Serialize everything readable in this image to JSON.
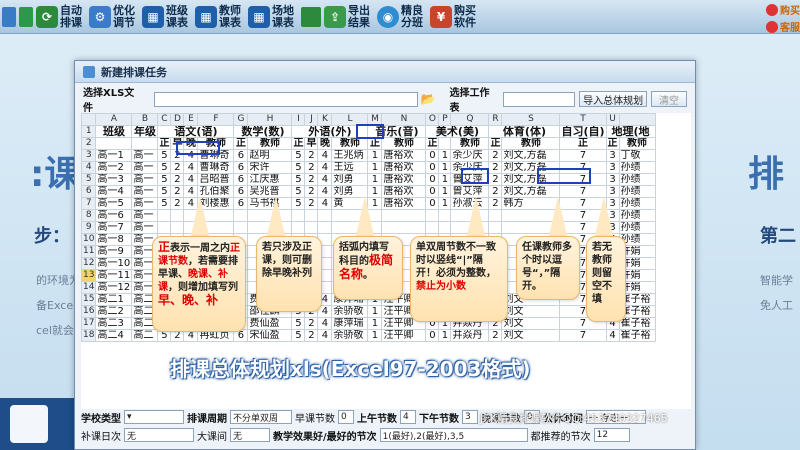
{
  "toolbar": {
    "items": [
      {
        "label": "自动排课",
        "icon": "auto-schedule-icon",
        "color": "#2d8a3c"
      },
      {
        "label": "优化调节",
        "icon": "optimize-icon",
        "color": "#3b7bc9"
      },
      {
        "label": "班级课表",
        "icon": "class-table-icon",
        "color": "#1f5fa8"
      },
      {
        "label": "教师课表",
        "icon": "teacher-table-icon",
        "color": "#1f5fa8"
      },
      {
        "label": "场地课表",
        "icon": "venue-table-icon",
        "color": "#1f5fa8"
      },
      {
        "label": "导出结果",
        "icon": "export-icon",
        "color": "#3a9a4a"
      },
      {
        "label": "精良分班",
        "icon": "split-class-icon",
        "color": "#2f8cd0"
      },
      {
        "label": "购买软件",
        "icon": "buy-icon",
        "color": "#c8442a"
      }
    ],
    "qq1": "购买",
    "qq2": "客服"
  },
  "background": {
    "left_big": ":课",
    "left_step": "步：",
    "left_small1": "的环境为",
    "left_small2": "备Excel",
    "left_small3": "cel就会",
    "right_big": "排",
    "right_mid": "第二",
    "right_small1": "智能学",
    "right_small2": "免人工"
  },
  "dialog": {
    "title": "新建排课任务",
    "file_label": "选择XLS文件",
    "sheet_label": "选择工作表",
    "import_btn": "导入总体规划",
    "clear_btn": "清空"
  },
  "sheet": {
    "col_letters": [
      "A",
      "B",
      "C",
      "D",
      "E",
      "F",
      "G",
      "H",
      "I",
      "J",
      "K",
      "L",
      "M",
      "N",
      "O",
      "P",
      "Q",
      "R",
      "S",
      "T",
      "U"
    ],
    "row_numbers": [
      "1",
      "2",
      "3",
      "4",
      "5",
      "6",
      "7",
      "8",
      "9",
      "10",
      "11",
      "12",
      "13",
      "14",
      "15",
      "16",
      "17",
      "18"
    ],
    "header1": {
      "class": "班级",
      "grade": "年级",
      "chinese": "语文(语)",
      "math": "数学(数)",
      "foreign": "外语(外)",
      "music": "音乐(音)",
      "art": "美术(美)",
      "pe": "体育(体)",
      "self": "自习(自)",
      "geo": "地理(地"
    },
    "header2": {
      "zheng": "正",
      "zao": "早",
      "wan": "晚",
      "teacher": "教师"
    },
    "rows": [
      {
        "cls": "高一1",
        "g": "高一",
        "c1": "5",
        "c2": "2",
        "c3": "4",
        "t1": "曹琳奇",
        "m1": "6",
        "t2": "赵明",
        "f1": "5",
        "f2": "2",
        "f3": "4",
        "t3": "王兆炳",
        "mu": "1",
        "t4": "唐裕欢",
        "a1": "0",
        "a2": "1",
        "t5": "余少庆",
        "p1": "2",
        "t6": "刘文,方磊",
        "s1": "7",
        "g1": "3",
        "t7": "丁敬"
      },
      {
        "cls": "高一2",
        "g": "高一",
        "c1": "5",
        "c2": "2",
        "c3": "4",
        "t1": "曹琳奇",
        "m1": "6",
        "t2": "宋许",
        "f1": "5",
        "f2": "2",
        "f3": "4",
        "t3": "王远",
        "mu": "1",
        "t4": "唐裕欢",
        "a1": "0",
        "a2": "1",
        "t5": "余少庆",
        "p1": "2",
        "t6": "刘文,方磊",
        "s1": "7",
        "g1": "3",
        "t7": "孙绩"
      },
      {
        "cls": "高一3",
        "g": "高一",
        "c1": "5",
        "c2": "2",
        "c3": "4",
        "t1": "吕昭普",
        "m1": "6",
        "t2": "江庆惠",
        "f1": "5",
        "f2": "2",
        "f3": "4",
        "t3": "刘勇",
        "mu": "1",
        "t4": "唐裕欢",
        "a1": "0",
        "a2": "1",
        "t5": "曾艾萍",
        "p1": "2",
        "t6": "刘文,方磊",
        "s1": "7",
        "g1": "3",
        "t7": "孙绩"
      },
      {
        "cls": "高一4",
        "g": "高一",
        "c1": "5",
        "c2": "2",
        "c3": "4",
        "t1": "孔伯聚",
        "m1": "6",
        "t2": "吴兆普",
        "f1": "5",
        "f2": "2",
        "f3": "4",
        "t3": "刘勇",
        "mu": "1",
        "t4": "唐裕欢",
        "a1": "0",
        "a2": "1",
        "t5": "曾艾萍",
        "p1": "2",
        "t6": "刘文,方磊",
        "s1": "7",
        "g1": "3",
        "t7": "孙绩"
      },
      {
        "cls": "高一5",
        "g": "高一",
        "c1": "5",
        "c2": "2",
        "c3": "4",
        "t1": "刘楼惠",
        "m1": "6",
        "t2": "马书祺",
        "f1": "5",
        "f2": "2",
        "f3": "4",
        "t3": "黄",
        "mu": "1",
        "t4": "唐裕欢",
        "a1": "0",
        "a2": "1",
        "t5": "孙淑云",
        "p1": "2",
        "t6": "韩方",
        "s1": "7",
        "g1": "3",
        "t7": "孙绩"
      },
      {
        "cls": "高一6",
        "g": "高一",
        "c1": "",
        "c2": "",
        "c3": "",
        "t1": "",
        "m1": "",
        "t2": "",
        "f1": "",
        "f2": "",
        "f3": "",
        "t3": "",
        "mu": "",
        "t4": "",
        "a1": "",
        "a2": "",
        "t5": "",
        "p1": "",
        "t6": "",
        "s1": "7",
        "g1": "3",
        "t7": "孙绩"
      },
      {
        "cls": "高一7",
        "g": "高一",
        "c1": "",
        "c2": "",
        "c3": "",
        "t1": "",
        "m1": "",
        "t2": "",
        "f1": "",
        "f2": "",
        "f3": "",
        "t3": "",
        "mu": "",
        "t4": "",
        "a1": "",
        "a2": "",
        "t5": "",
        "p1": "",
        "t6": "",
        "s1": "7",
        "g1": "3",
        "t7": "孙绩"
      },
      {
        "cls": "高一8",
        "g": "高一",
        "c1": "",
        "c2": "",
        "c3": "",
        "t1": "",
        "m1": "",
        "t2": "",
        "f1": "",
        "f2": "",
        "f3": "",
        "t3": "",
        "mu": "",
        "t4": "",
        "a1": "",
        "a2": "",
        "t5": "",
        "p1": "",
        "t6": "",
        "s1": "7",
        "g1": "3",
        "t7": "孙绩"
      },
      {
        "cls": "高一9",
        "g": "高一",
        "c1": "",
        "c2": "",
        "c3": "",
        "t1": "",
        "m1": "",
        "t2": "",
        "f1": "",
        "f2": "",
        "f3": "",
        "t3": "",
        "mu": "",
        "t4": "",
        "a1": "",
        "a2": "",
        "t5": "",
        "p1": "",
        "t6": "",
        "s1": "7",
        "g1": "3",
        "t7": "许娟"
      },
      {
        "cls": "高一10",
        "g": "高一",
        "c1": "",
        "c2": "",
        "c3": "",
        "t1": "",
        "m1": "",
        "t2": "",
        "f1": "",
        "f2": "",
        "f3": "",
        "t3": "",
        "mu": "",
        "t4": "",
        "a1": "",
        "a2": "",
        "t5": "",
        "p1": "",
        "t6": "",
        "s1": "7",
        "g1": "3",
        "t7": "许娟"
      },
      {
        "cls": "高一11",
        "g": "高一",
        "c1": "",
        "c2": "",
        "c3": "",
        "t1": "",
        "m1": "",
        "t2": "",
        "f1": "",
        "f2": "",
        "f3": "",
        "t3": "",
        "mu": "",
        "t4": "",
        "a1": "",
        "a2": "",
        "t5": "",
        "p1": "",
        "t6": "",
        "s1": "7",
        "g1": "3",
        "t7": "许娟"
      },
      {
        "cls": "高一12",
        "g": "高一",
        "c1": "",
        "c2": "",
        "c3": "",
        "t1": "",
        "m1": "",
        "t2": "",
        "f1": "",
        "f2": "",
        "f3": "",
        "t3": "",
        "mu": "",
        "t4": "",
        "a1": "",
        "a2": "",
        "t5": "",
        "p1": "",
        "t6": "",
        "s1": "7",
        "g1": "3",
        "t7": "许娟"
      },
      {
        "cls": "高二1",
        "g": "高二",
        "c1": "5",
        "c2": "2",
        "c3": "4",
        "t1": "蒋景堂",
        "m1": "6",
        "t2": "费仙盈",
        "f1": "5",
        "f2": "2",
        "f3": "4",
        "t3": "康萍瑞",
        "mu": "1",
        "t4": "汪平卿",
        "a1": "0",
        "a2": "1",
        "t5": "井焱丹",
        "p1": "2",
        "t6": "刘文",
        "s1": "7",
        "g1": "4",
        "t7": "崔子裕"
      },
      {
        "cls": "高二2",
        "g": "高二",
        "c1": "5",
        "c2": "2",
        "c3": "4",
        "t1": "冉虹贞",
        "m1": "6",
        "t2": "邵仕麟",
        "f1": "5",
        "f2": "2",
        "f3": "4",
        "t3": "余骄敬",
        "mu": "1",
        "t4": "汪平卿",
        "a1": "0",
        "a2": "1",
        "t5": "井焱丹",
        "p1": "2",
        "t6": "刘文",
        "s1": "7",
        "g1": "4",
        "t7": "崔子裕"
      },
      {
        "cls": "高二3",
        "g": "高二",
        "c1": "5",
        "c2": "2",
        "c3": "4",
        "t1": "蒋景堂",
        "m1": "6",
        "t2": "费仙盈",
        "f1": "5",
        "f2": "2",
        "f3": "4",
        "t3": "康萍瑞",
        "mu": "1",
        "t4": "汪平卿",
        "a1": "0",
        "a2": "1",
        "t5": "井焱丹",
        "p1": "2",
        "t6": "刘文",
        "s1": "7",
        "g1": "4",
        "t7": "崔子裕"
      },
      {
        "cls": "高二4",
        "g": "高二",
        "c1": "5",
        "c2": "2",
        "c3": "4",
        "t1": "冉虹贞",
        "m1": "6",
        "t2": "宋仙盈",
        "f1": "5",
        "f2": "2",
        "f3": "4",
        "t3": "余骄敬",
        "mu": "1",
        "t4": "汪平卿",
        "a1": "0",
        "a2": "1",
        "t5": "井焱丹",
        "p1": "2",
        "t6": "刘文",
        "s1": "7",
        "g1": "4",
        "t7": "崔子裕"
      }
    ]
  },
  "notes": {
    "n1_a": "正",
    "n1_b": "表示一周之内",
    "n1_c": "正课节数",
    "n1_d": "，若需要排早课、",
    "n1_e": "晚课、补课",
    "n1_f": "，则增加填写列",
    "n1_g": "早、晚、补",
    "n2": "若只涉及正课，则可删除早晚补列",
    "n3_a": "括弧内填写科目的",
    "n3_b": "极简名称",
    "n3_c": "。",
    "n4_a": "单双周节数不一致时以竖线“|”隔开！必须为整数，",
    "n4_b": "禁止为小数",
    "n5": "任课教师多个时以逗号“，”隔开。",
    "n6": "若无教师则留空不填"
  },
  "banner": "排课总体规划xls(Excel97-2003格式)",
  "settings": {
    "school_type_label": "学校类型",
    "cycle_label": "排课周期",
    "cycle_value": "不分单双周",
    "morning_label": "早课节数",
    "morning_value": "0",
    "am_label": "上午节数",
    "am_value": "4",
    "pm_label": "下午节数",
    "pm_value": "3",
    "evening_label": "晚课节数",
    "evening_value": "0",
    "public_label": "公休时间",
    "public_value": "一  存志一",
    "makeup_label": "补课日次",
    "makeup_value": "无",
    "big_break_label": "大课间",
    "big_break_value": "无",
    "effect_label": "教学效果好/最好的节次",
    "effect_value": "1(最好),2(最好),3,5",
    "avoid_label": "都推荐的节次",
    "avoid_value": "12"
  },
  "watermark": "JFK精良排课软件QQ:453740327465"
}
